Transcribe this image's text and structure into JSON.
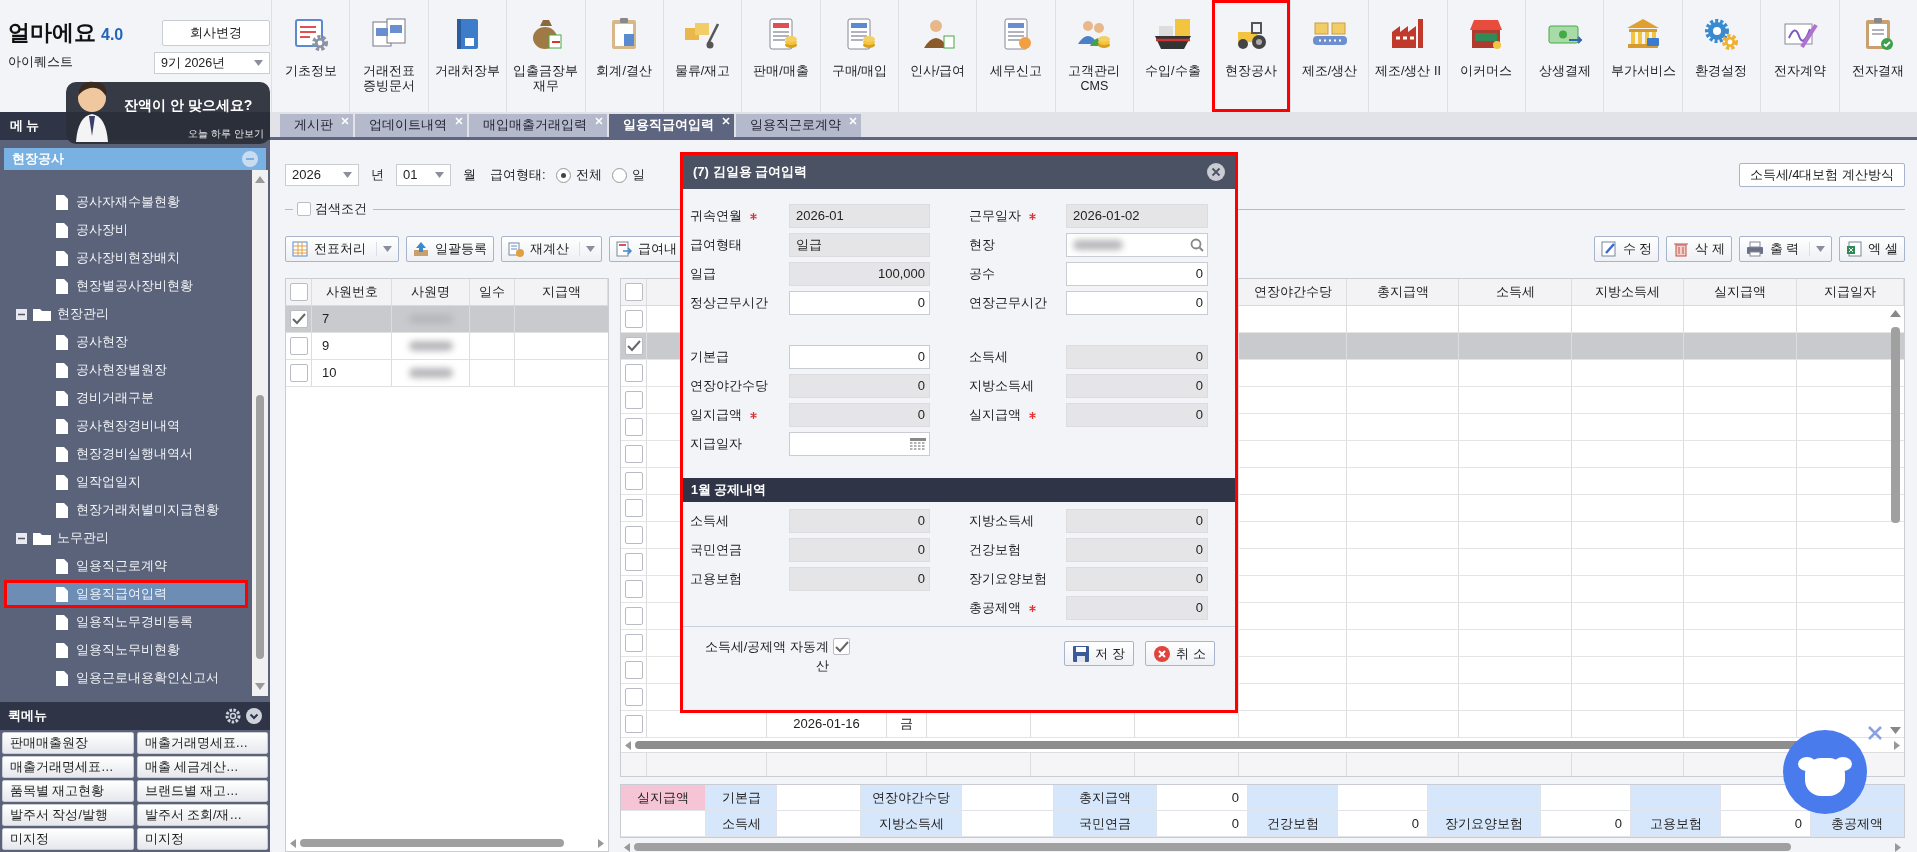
{
  "app": {
    "logo": "얼마에요",
    "version": "4.0",
    "company": "아이퀘스트",
    "change_company_button": "회사변경",
    "period": "9기 2026년"
  },
  "toolbar": [
    {
      "label": "기초정보",
      "highlighted": false
    },
    {
      "label": "거래전표\n증빙문서",
      "highlighted": false
    },
    {
      "label": "거래처장부",
      "highlighted": false
    },
    {
      "label": "입출금장부\n재무",
      "highlighted": false
    },
    {
      "label": "회계/결산",
      "highlighted": false
    },
    {
      "label": "물류/재고",
      "highlighted": false
    },
    {
      "label": "판매/매출",
      "highlighted": false
    },
    {
      "label": "구매/매입",
      "highlighted": false
    },
    {
      "label": "인사/급여",
      "highlighted": false
    },
    {
      "label": "세무신고",
      "highlighted": false
    },
    {
      "label": "고객관리\nCMS",
      "highlighted": false
    },
    {
      "label": "수입/수출",
      "highlighted": false
    },
    {
      "label": "현장공사",
      "highlighted": true
    },
    {
      "label": "제조/생산",
      "highlighted": false
    },
    {
      "label": "제조/생산 II",
      "highlighted": false
    },
    {
      "label": "이커머스",
      "highlighted": false
    },
    {
      "label": "상생결제",
      "highlighted": false
    },
    {
      "label": "부가서비스",
      "highlighted": false
    },
    {
      "label": "환경설정",
      "highlighted": false
    },
    {
      "label": "전자계약",
      "highlighted": false
    },
    {
      "label": "전자결재",
      "highlighted": false
    }
  ],
  "promo": {
    "headline": "잔액이 안 맞으세요?",
    "dismiss": "오늘 하루 안보기"
  },
  "menu_title": "메 뉴",
  "tabs": [
    {
      "label": "게시판",
      "selected": false
    },
    {
      "label": "업데이트내역",
      "selected": false
    },
    {
      "label": "매입매출거래입력",
      "selected": false
    },
    {
      "label": "일용직급여입력",
      "selected": true
    },
    {
      "label": "일용직근로계약",
      "selected": false
    }
  ],
  "sidebar": {
    "section": {
      "title": "현장공사",
      "expanded": true
    },
    "tree": [
      {
        "label": "공사자재수불현황",
        "selected": false,
        "highlighted": false
      },
      {
        "label": "공사장비",
        "selected": false,
        "highlighted": false
      },
      {
        "label": "공사장비현장배치",
        "selected": false,
        "highlighted": false
      },
      {
        "label": "현장별공사장비현황",
        "selected": false,
        "highlighted": false
      },
      {
        "label": "현장관리",
        "expanded": true,
        "children": [
          {
            "label": "공사현장",
            "selected": false,
            "highlighted": false
          },
          {
            "label": "공사현장별원장",
            "selected": false,
            "highlighted": false
          },
          {
            "label": "경비거래구분",
            "selected": false,
            "highlighted": false
          },
          {
            "label": "공사현장경비내역",
            "selected": false,
            "highlighted": false
          },
          {
            "label": "현장경비실행내역서",
            "selected": false,
            "highlighted": false
          },
          {
            "label": "일작업일지",
            "selected": false,
            "highlighted": false
          },
          {
            "label": "현장거래처별미지급현황",
            "selected": false,
            "highlighted": false
          }
        ]
      },
      {
        "label": "노무관리",
        "expanded": true,
        "children": [
          {
            "label": "일용직근로계약",
            "selected": false,
            "highlighted": false
          },
          {
            "label": "일용직급여입력",
            "selected": true,
            "highlighted": true
          },
          {
            "label": "일용직노무경비등록",
            "selected": false,
            "highlighted": false
          },
          {
            "label": "일용직노무비현황",
            "selected": false,
            "highlighted": false
          },
          {
            "label": "일용근로내용확인신고서",
            "selected": false,
            "highlighted": false
          }
        ]
      }
    ]
  },
  "quick_menu": {
    "title": "퀵메뉴",
    "items": [
      "판매매출원장",
      "매출거래명세표…",
      "매출거래명세표…",
      "매출 세금계산…",
      "품목별 재고현황",
      "브랜드별 재고…",
      "발주서 작성/발행",
      "발주서 조회/재…",
      "미지정",
      "미지정"
    ]
  },
  "filters": {
    "year": "2026",
    "year_unit": "년",
    "month": "01",
    "month_unit": "월",
    "pay_type_label": "급여형태:",
    "pay_types": [
      {
        "label": "전체",
        "selected": true
      },
      {
        "label": "일",
        "selected": false
      }
    ],
    "calc_method_button": "소득세/4대보험 계산방식",
    "search_toggle": {
      "label": "검색조건",
      "checked": false
    }
  },
  "actions": {
    "left": [
      {
        "label": "전표처리",
        "dropdown": true
      },
      {
        "label": "일괄등록",
        "dropdown": false
      },
      {
        "label": "재계산",
        "dropdown": true
      },
      {
        "label": "급여내",
        "dropdown": false
      }
    ],
    "right": [
      {
        "label": "수 정",
        "dropdown": false
      },
      {
        "label": "삭 제",
        "dropdown": false
      },
      {
        "label": "출 력",
        "dropdown": true
      },
      {
        "label": "엑 셀",
        "dropdown": false
      }
    ]
  },
  "employee_grid": {
    "header_checked": false,
    "columns": [
      "사원번호",
      "사원명",
      "일수",
      "지급액"
    ],
    "rows": [
      {
        "employee_no": "7",
        "checked": true,
        "selected": true
      },
      {
        "employee_no": "9",
        "checked": false,
        "selected": false
      },
      {
        "employee_no": "10",
        "checked": false,
        "selected": false
      }
    ]
  },
  "payroll_grid": {
    "header_checked": false,
    "columns": [
      "연장야간수당",
      "총지급액",
      "소득세",
      "지방소득세",
      "실지급액",
      "지급일자"
    ],
    "rows": [
      {
        "checked": false,
        "selected": false
      },
      {
        "checked": true,
        "selected": true
      },
      {
        "checked": false,
        "selected": false
      },
      {
        "checked": false,
        "selected": false
      },
      {
        "checked": false,
        "selected": false
      },
      {
        "checked": false,
        "selected": false
      },
      {
        "checked": false,
        "selected": false
      },
      {
        "checked": false,
        "selected": false
      },
      {
        "checked": false,
        "selected": false
      },
      {
        "checked": false,
        "selected": false
      },
      {
        "checked": false,
        "selected": false
      },
      {
        "checked": false,
        "selected": false
      },
      {
        "checked": false,
        "selected": false
      },
      {
        "checked": false,
        "selected": false
      },
      {
        "checked": false,
        "selected": false
      },
      {
        "checked": false,
        "selected": false,
        "column_3": "2026-01-16",
        "column_4": "금"
      }
    ]
  },
  "summary": {
    "rows": [
      [
        {
          "kind": "highlight",
          "text": "실지급액"
        },
        {
          "kind": "label",
          "text": "기본급"
        },
        {
          "kind": "value"
        },
        {
          "kind": "label",
          "text": "연장야간수당"
        },
        {
          "kind": "value"
        },
        {
          "kind": "label",
          "text": "총지급액"
        },
        {
          "kind": "value",
          "text": "0"
        },
        {
          "kind": "label"
        },
        {
          "kind": "value"
        },
        {
          "kind": "label"
        },
        {
          "kind": "value"
        },
        {
          "kind": "label"
        },
        {
          "kind": "value"
        },
        {
          "kind": "label"
        }
      ],
      [
        {
          "kind": "value"
        },
        {
          "kind": "label",
          "text": "소득세"
        },
        {
          "kind": "value"
        },
        {
          "kind": "label",
          "text": "지방소득세"
        },
        {
          "kind": "value"
        },
        {
          "kind": "label",
          "text": "국민연금"
        },
        {
          "kind": "value",
          "text": "0"
        },
        {
          "kind": "label",
          "text": "건강보험"
        },
        {
          "kind": "value",
          "text": "0"
        },
        {
          "kind": "label",
          "text": "장기요양보험"
        },
        {
          "kind": "value",
          "text": "0"
        },
        {
          "kind": "label",
          "text": "고용보험"
        },
        {
          "kind": "value",
          "text": "0"
        },
        {
          "kind": "label",
          "text": "총공제액"
        }
      ]
    ]
  },
  "dialog": {
    "title": "(7) 김일용 급여입력",
    "highlighted": true,
    "groups": [
      {
        "rows": [
          [
            {
              "label": "귀속연월",
              "required": true,
              "kind": "text",
              "editable": false,
              "value": "2026-01"
            },
            {
              "label": "근무일자",
              "required": true,
              "kind": "text",
              "editable": false,
              "value": "2026-01-02"
            }
          ],
          [
            {
              "label": "급여형태",
              "required": false,
              "kind": "text",
              "editable": false,
              "value": "일급"
            },
            {
              "label": "현장",
              "required": false,
              "kind": "search",
              "editable": true
            }
          ],
          [
            {
              "label": "일급",
              "required": false,
              "kind": "number",
              "editable": false,
              "value": "100,000"
            },
            {
              "label": "공수",
              "required": false,
              "kind": "number",
              "editable": true,
              "value": "0"
            }
          ],
          [
            {
              "label": "정상근무시간",
              "required": false,
              "kind": "number",
              "editable": true,
              "value": "0"
            },
            {
              "label": "연장근무시간",
              "required": false,
              "kind": "number",
              "editable": true,
              "value": "0"
            }
          ]
        ]
      },
      {
        "rows": [
          [
            {
              "label": "기본급",
              "required": false,
              "kind": "number",
              "editable": true,
              "value": "0"
            },
            {
              "label": "소득세",
              "required": false,
              "kind": "number",
              "editable": false,
              "value": "0"
            }
          ],
          [
            {
              "label": "연장야간수당",
              "required": false,
              "kind": "number",
              "editable": false,
              "value": "0"
            },
            {
              "label": "지방소득세",
              "required": false,
              "kind": "number",
              "editable": false,
              "value": "0"
            }
          ],
          [
            {
              "label": "일지급액",
              "required": true,
              "kind": "number",
              "editable": false,
              "value": "0"
            },
            {
              "label": "실지급액",
              "required": true,
              "kind": "number",
              "editable": false,
              "value": "0"
            }
          ],
          [
            {
              "label": "지급일자",
              "required": false,
              "kind": "date",
              "editable": true
            }
          ]
        ]
      },
      {
        "title": "1월 공제내역",
        "rows": [
          [
            {
              "label": "소득세",
              "required": false,
              "kind": "number",
              "editable": false,
              "value": "0"
            },
            {
              "label": "지방소득세",
              "required": false,
              "kind": "number",
              "editable": false,
              "value": "0"
            }
          ],
          [
            {
              "label": "국민연금",
              "required": false,
              "kind": "number",
              "editable": false,
              "value": "0"
            },
            {
              "label": "건강보험",
              "required": false,
              "kind": "number",
              "editable": false,
              "value": "0"
            }
          ],
          [
            {
              "label": "고용보험",
              "required": false,
              "kind": "number",
              "editable": false,
              "value": "0"
            },
            {
              "label": "장기요양보험",
              "required": false,
              "kind": "number",
              "editable": false,
              "value": "0"
            }
          ],
          [
            null,
            {
              "label": "총공제액",
              "required": true,
              "kind": "number",
              "editable": false,
              "value": "0"
            }
          ]
        ]
      }
    ],
    "auto_calc": {
      "label": "소득세/공제액 자동계산",
      "checked": true
    },
    "buttons": [
      {
        "label": "저 장",
        "kind": "save"
      },
      {
        "label": "취 소",
        "kind": "cancel"
      }
    ]
  }
}
